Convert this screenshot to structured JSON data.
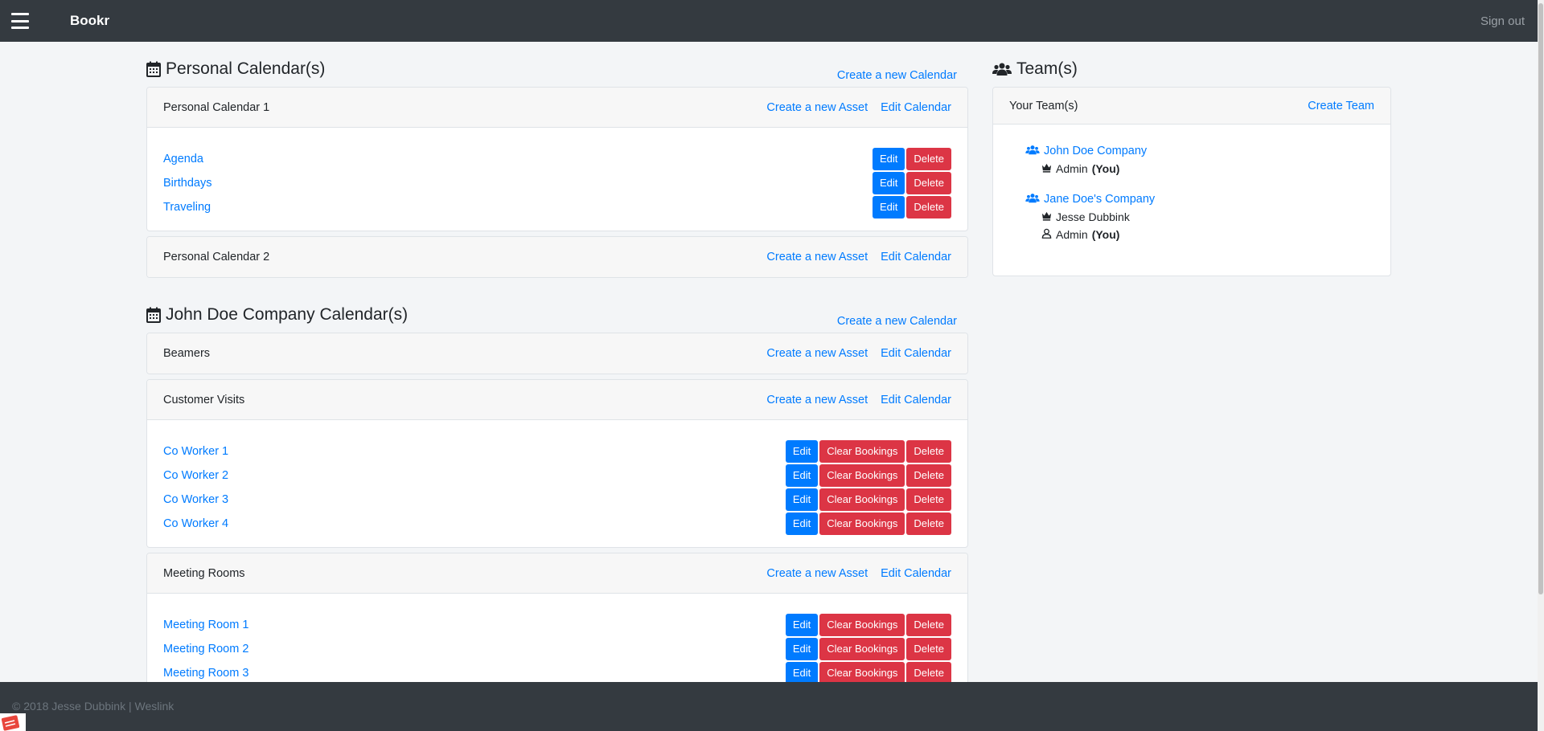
{
  "navbar": {
    "brand": "Bookr",
    "sign_out": "Sign out"
  },
  "personal": {
    "title": "Personal Calendar(s)",
    "create_calendar": "Create a new Calendar",
    "calendars": [
      {
        "name": "Personal Calendar 1",
        "create_asset": "Create a new Asset",
        "edit_calendar": "Edit Calendar",
        "assets": [
          {
            "name": "Agenda",
            "edit": "Edit",
            "delete": "Delete"
          },
          {
            "name": "Birthdays",
            "edit": "Edit",
            "delete": "Delete"
          },
          {
            "name": "Traveling",
            "edit": "Edit",
            "delete": "Delete"
          }
        ]
      },
      {
        "name": "Personal Calendar 2",
        "create_asset": "Create a new Asset",
        "edit_calendar": "Edit Calendar"
      }
    ]
  },
  "company": {
    "title": "John Doe Company Calendar(s)",
    "create_calendar": "Create a new Calendar",
    "calendars": [
      {
        "name": "Beamers",
        "create_asset": "Create a new Asset",
        "edit_calendar": "Edit Calendar"
      },
      {
        "name": "Customer Visits",
        "create_asset": "Create a new Asset",
        "edit_calendar": "Edit Calendar",
        "assets": [
          {
            "name": "Co Worker 1",
            "edit": "Edit",
            "clear": "Clear Bookings",
            "delete": "Delete"
          },
          {
            "name": "Co Worker 2",
            "edit": "Edit",
            "clear": "Clear Bookings",
            "delete": "Delete"
          },
          {
            "name": "Co Worker 3",
            "edit": "Edit",
            "clear": "Clear Bookings",
            "delete": "Delete"
          },
          {
            "name": "Co Worker 4",
            "edit": "Edit",
            "clear": "Clear Bookings",
            "delete": "Delete"
          }
        ]
      },
      {
        "name": "Meeting Rooms",
        "create_asset": "Create a new Asset",
        "edit_calendar": "Edit Calendar",
        "assets": [
          {
            "name": "Meeting Room 1",
            "edit": "Edit",
            "clear": "Clear Bookings",
            "delete": "Delete"
          },
          {
            "name": "Meeting Room 2",
            "edit": "Edit",
            "clear": "Clear Bookings",
            "delete": "Delete"
          },
          {
            "name": "Meeting Room 3",
            "edit": "Edit",
            "clear": "Clear Bookings",
            "delete": "Delete"
          }
        ]
      }
    ]
  },
  "teams": {
    "title": "Team(s)",
    "card_title": "Your Team(s)",
    "create_team": "Create Team",
    "list": [
      {
        "name": "John Doe Company",
        "members": [
          {
            "icon": "crown-icon",
            "name": "Admin",
            "you": "(You)"
          }
        ]
      },
      {
        "name": "Jane Doe's Company",
        "members": [
          {
            "icon": "crown-icon",
            "name": "Jesse Dubbink",
            "you": ""
          },
          {
            "icon": "user-icon",
            "name": "Admin",
            "you": "(You)"
          }
        ]
      }
    ]
  },
  "footer": {
    "text": "© 2018 Jesse Dubbink | Weslink"
  },
  "colors": {
    "navbar": "#343a40",
    "link": "#007bff",
    "primary": "#007bff",
    "danger": "#dc3545",
    "background": "#f3f5f7"
  }
}
